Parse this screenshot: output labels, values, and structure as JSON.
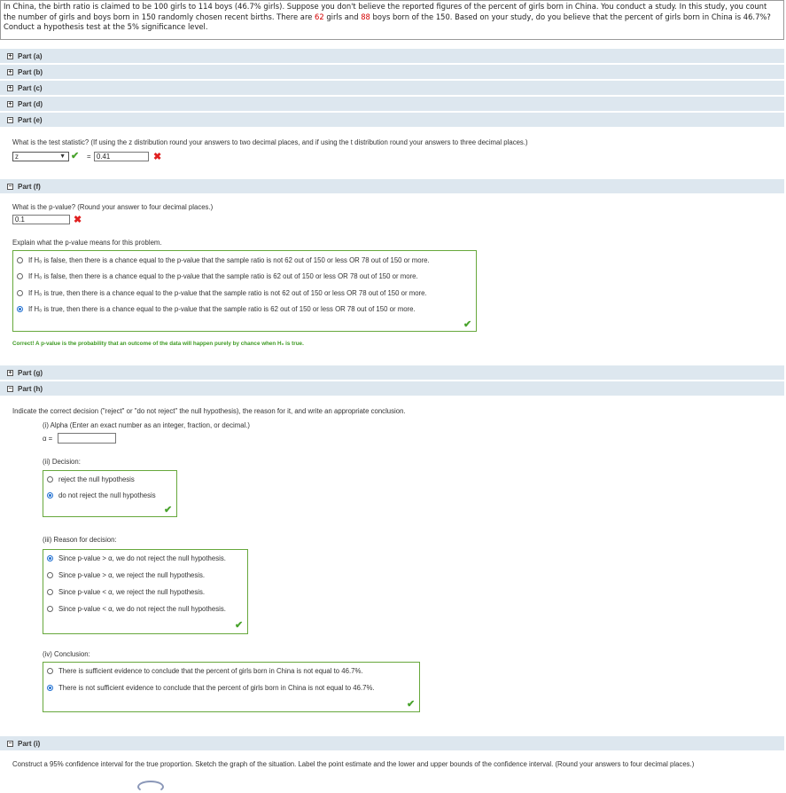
{
  "problem": {
    "text_1": "In China, the birth ratio is claimed to be 100 girls to 114 boys (46.7% girls). Suppose you don't believe the reported figures of the percent of girls born in China. You conduct a study. In this study, you count the number of girls and boys born in 150 randomly chosen recent births. There are ",
    "girls": "62",
    "text_2": " girls and ",
    "boys": "88",
    "text_3": " boys born of the 150. Based on your study, do you believe that the percent of girls born in China is 46.7%? Conduct a hypothesis test at the 5% significance level."
  },
  "parts": {
    "a": "Part (a)",
    "b": "Part (b)",
    "c": "Part (c)",
    "d": "Part (d)",
    "e": "Part (e)",
    "f": "Part (f)",
    "g": "Part (g)",
    "h": "Part (h)",
    "i": "Part (i)"
  },
  "part_e": {
    "question": "What is the test statistic? (If using the z distribution round your answers to two decimal places, and if using the t distribution round your answers to three decimal places.)",
    "distribution": "z",
    "equals": "=",
    "answer": "0.41"
  },
  "part_f": {
    "question": "What is the p-value? (Round your answer to four decimal places.)",
    "answer": "0.1",
    "explain_prompt": "Explain what the p-value means for this problem.",
    "options": [
      "If H₀ is false, then there is a chance equal to the p-value that the sample ratio is not 62 out of 150 or less OR 78 out of 150 or more.",
      "If H₀ is false, then there is a chance equal to the p-value that the sample ratio is 62 out of 150 or less OR 78 out of 150 or more.",
      "If H₀ is true, then there is a chance equal to the p-value that the sample ratio is not 62 out of 150 or less OR 78 out of 150 or more.",
      "If H₀ is true, then there is a chance equal to the p-value that the sample ratio is 62 out of 150 or less OR 78 out of 150 or more."
    ],
    "correct_text": "Correct! A p-value is the probability that an outcome of the data will happen purely by chance when H₀ is true."
  },
  "part_h": {
    "intro": "Indicate the correct decision (\"reject\" or \"do not reject\" the null hypothesis), the reason for it, and write an appropriate conclusion.",
    "alpha_label": "(i) Alpha (Enter an exact number as an integer, fraction, or decimal.)",
    "alpha_eq": "α =",
    "alpha_value": "",
    "decision_label": "(ii) Decision:",
    "decision_options": [
      "reject the null hypothesis",
      "do not reject the null hypothesis"
    ],
    "reason_label": "(iii) Reason for decision:",
    "reason_options": [
      "Since p-value > α, we do not reject the null hypothesis.",
      "Since p-value > α, we reject the null hypothesis.",
      "Since p-value < α, we reject the null hypothesis.",
      "Since p-value < α, we do not reject the null hypothesis."
    ],
    "conclusion_label": "(iv) Conclusion:",
    "conclusion_options": [
      "There is sufficient evidence to conclude that the percent of girls born in China is not equal to 46.7%.",
      "There is not sufficient evidence to conclude that the percent of girls born in China is not equal to 46.7%."
    ]
  },
  "part_i": {
    "question": "Construct a 95% confidence interval for the true proportion. Sketch the graph of the situation. Label the point estimate and the lower and upper bounds of the confidence interval. (Round your answers to four decimal places.)"
  },
  "colors": {
    "header_bar": "#dde7ef",
    "correct_green": "#3e9a23",
    "wrong_red": "#e02020",
    "selected_blue": "#1f6fd1"
  }
}
